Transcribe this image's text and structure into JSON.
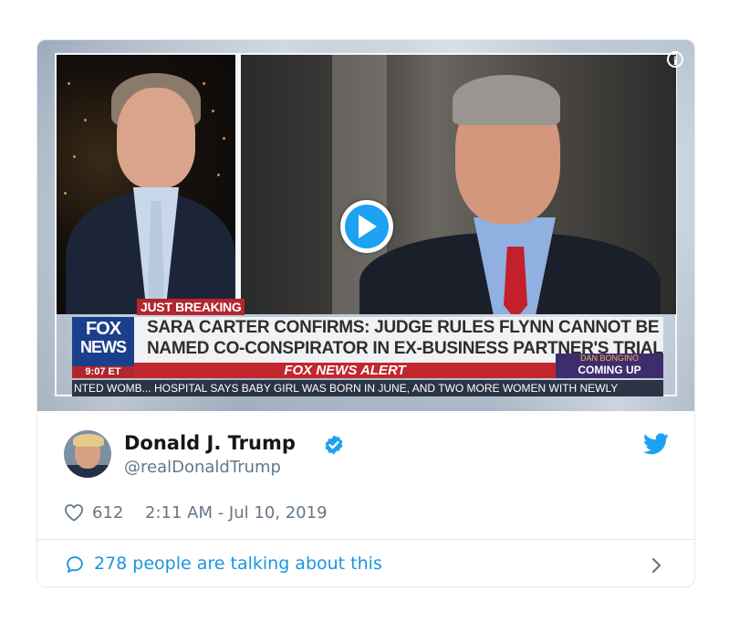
{
  "video": {
    "breaking_tag": "JUST BREAKING",
    "logo_line1": "FOX",
    "logo_line2": "NEWS",
    "time": "9:07 ET",
    "headline_line1": "SARA CARTER CONFIRMS: JUDGE RULES FLYNN CANNOT BE",
    "headline_line2": "NAMED CO-CONSPIRATOR IN EX-BUSINESS PARTNER'S TRIAL",
    "alert": "FOX NEWS ALERT",
    "coming_up_name": "DAN BONGINO",
    "coming_up_label": "COMING UP",
    "ticker": "NTED WOMB...   HOSPITAL SAYS BABY GIRL WAS BORN IN JUNE, AND TWO MORE WOMEN WITH NEWLY",
    "info_icon": "info-icon",
    "play_icon": "play-icon"
  },
  "tweet": {
    "name": "Donald J. Trump",
    "handle": "@realDonaldTrump",
    "likes": "612",
    "timestamp": "2:11 AM - Jul 10, 2019",
    "talking": "278 people are talking about this"
  },
  "colors": {
    "twitter_blue": "#1da1f2",
    "link_blue": "#1b95e0",
    "muted": "#657786",
    "fox_red": "#c1272d"
  }
}
